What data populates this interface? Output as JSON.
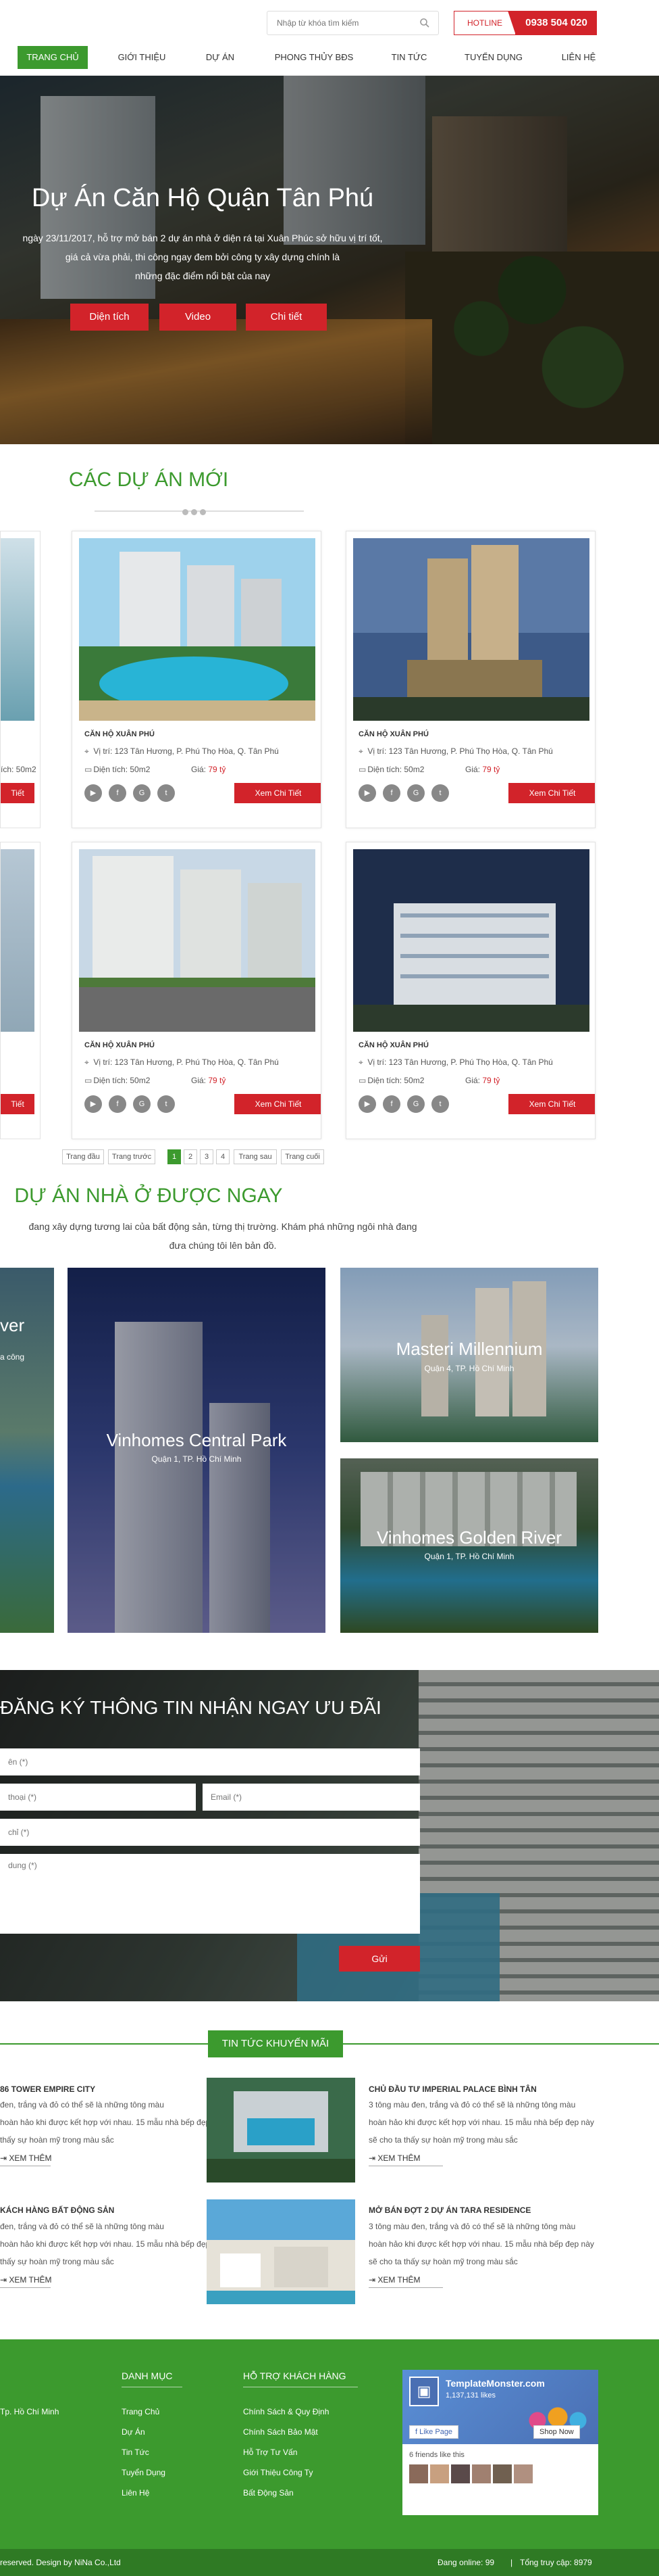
{
  "header": {
    "search_placeholder": "Nhập từ khóa tìm kiếm",
    "hotline_label": "HOTLINE",
    "hotline_number": "0938 504 020"
  },
  "nav": [
    "TRANG CHỦ",
    "GIỚI THIỆU",
    "DỰ ÁN",
    "PHONG THỦY BĐS",
    "TIN TỨC",
    "TUYỂN DỤNG",
    "LIÊN HỆ"
  ],
  "hero": {
    "title": "Dự Án Căn Hộ Quận Tân Phú",
    "desc_line1": "ngày 23/11/2017, hỗ trợ mở bán 2 dự án nhà ở diện rá tại Xuân Phúc sở hữu vị trí tốt,",
    "desc_line2": "giá cả vừa phải, thi công ngay đem bởi công ty xây dựng chính là",
    "desc_line3": "những đặc điểm nổi bật của nay",
    "buttons": [
      "Diện tích",
      "Video",
      "Chi tiết"
    ]
  },
  "new_projects": {
    "title": "CÁC DỰ ÁN MỚI",
    "cards": [
      {
        "name": "CĂN HỘ XUÂN PHÚ",
        "address": "Vị trí: 123 Tân Hương, P. Phú Thọ Hòa, Q. Tân Phú",
        "area": "Diện tích: 50m2",
        "price_label": "Giá:",
        "price": "79 tỷ",
        "more": "Xem Chi Tiết"
      },
      {
        "name": "CĂN HỘ XUÂN PHÚ",
        "address": "Vị trí: 123 Tân Hương, P. Phú Thọ Hòa, Q. Tân Phú",
        "area": "Diện tích: 50m2",
        "price_label": "Giá:",
        "price": "79 tỷ",
        "more": "Xem Chi Tiết"
      },
      {
        "name": "CĂN HỘ XUÂN PHÚ",
        "address": "Vị trí: 123 Tân Hương, P. Phú Thọ Hòa, Q. Tân Phú",
        "area": "Diện tích: 50m2",
        "price_label": "Giá:",
        "price": "79 tỷ",
        "more": "Xem Chi Tiết"
      },
      {
        "name": "CĂN HỘ XUÂN PHÚ",
        "address": "Vị trí: 123 Tân Hương, P. Phú Thọ Hòa, Q. Tân Phú",
        "area": "Diện tích: 50m2",
        "price_label": "Giá:",
        "price": "79 tỷ",
        "more": "Xem Chi Tiết"
      }
    ],
    "edge_left": {
      "area": "ích: 50m2",
      "more": "Tiết"
    },
    "edge_right": {
      "more": "Xem Chi Tiết"
    }
  },
  "pagination": {
    "first": "Trang đầu",
    "prev": "Trang trước",
    "pages": [
      "1",
      "2",
      "3",
      "4"
    ],
    "next": "Trang sau",
    "last": "Trang cuối",
    "active": "1"
  },
  "featured": {
    "title": "DỰ ÁN NHÀ Ở ĐƯỢC NGAY",
    "desc_line1": "đang xây dựng tương lai của bất động sản, từng thị trường. Khám phá những ngôi nhà đang",
    "desc_line2": "đưa chúng tôi lên bản đồ.",
    "items": [
      {
        "name": "Vinhomes Central Park",
        "location": "Quận 1, TP. Hồ Chí Minh"
      },
      {
        "name": "Masteri Millennium",
        "location": "Quận 4, TP. Hồ Chí Minh"
      },
      {
        "name": "Vinhomes Golden River",
        "location": "Quận 1, TP. Hồ Chí Minh"
      }
    ],
    "edge_left_text": "ver",
    "edge_left_sub": "a công"
  },
  "register": {
    "title": "ĐĂNG KÝ THÔNG TIN NHẬN NGAY ƯU ĐÃI",
    "name_ph": "ên (*)",
    "phone_ph": "thoại (*)",
    "email_ph": "Email (*)",
    "address_ph": "chỉ (*)",
    "content_ph": "dung (*)",
    "send": "Gửi"
  },
  "news": {
    "title": "TIN TỨC KHUYẾN MÃI",
    "items": [
      {
        "title": "86 TOWER EMPIRE CITY",
        "d1": "đen, trắng và đỏ có thể sẽ là những tông màu",
        "d2": "hoàn hảo khi được kết hợp với nhau. 15 mẫu nhà bếp đẹp này",
        "d3": "thấy sự hoàn mỹ trong màu sắc",
        "more": "XEM THÊM"
      },
      {
        "title": "CHỦ ĐẦU TƯ IMPERIAL PALACE BÌNH TÂN",
        "d1": "3 tông màu đen, trắng và đỏ có thể sẽ là những tông màu",
        "d2": "hoàn hảo khi được kết hợp với nhau. 15 mẫu nhà bếp đẹp này",
        "d3": "sẽ cho ta thấy sự hoàn mỹ trong màu sắc",
        "more": "XEM THÊM"
      },
      {
        "title": "KÁCH HÀNG BẤT ĐỘNG SẢN",
        "d1": "đen, trắng và đỏ có thể sẽ là những tông màu",
        "d2": "hoàn hảo khi được kết hợp với nhau. 15 mẫu nhà bếp đẹp này",
        "d3": "thấy sự hoàn mỹ trong màu sắc",
        "more": "XEM THÊM"
      },
      {
        "title": "MỞ BÁN ĐỢT 2 DỰ ÁN TARA RESIDENCE",
        "d1": "3 tông màu đen, trắng và đỏ có thể sẽ là những tông màu",
        "d2": "hoàn hảo khi được kết hợp với nhau. 15 mẫu nhà bếp đẹp này",
        "d3": "sẽ cho ta thấy sự hoàn mỹ trong màu sắc",
        "more": "XEM THÊM"
      }
    ]
  },
  "footer": {
    "address": "Tp. Hồ Chí Minh",
    "col1_title": "DANH MỤC",
    "col1": [
      "Trang Chủ",
      "Dự Án",
      "Tin Tức",
      "Tuyển Dụng",
      "Liên Hệ"
    ],
    "col2_title": "HỖ TRỢ KHÁCH HÀNG",
    "col2": [
      "Chính Sách & Quy Định",
      "Chính Sách Bảo Mật",
      "Hỗ Trợ Tư Vấn",
      "Giới Thiệu Công Ty",
      "Bất Động Sản"
    ],
    "fb_name": "TemplateMonster.com",
    "fb_likes": "1,137,131 likes",
    "fb_like_btn": "Like Page",
    "fb_shop_btn": "Shop Now",
    "fb_friends": "6 friends like this",
    "copyright": "reserved. Design by NiNa Co.,Ltd",
    "online": "Đang online: 99",
    "total": "Tổng truy cập: 8979"
  }
}
